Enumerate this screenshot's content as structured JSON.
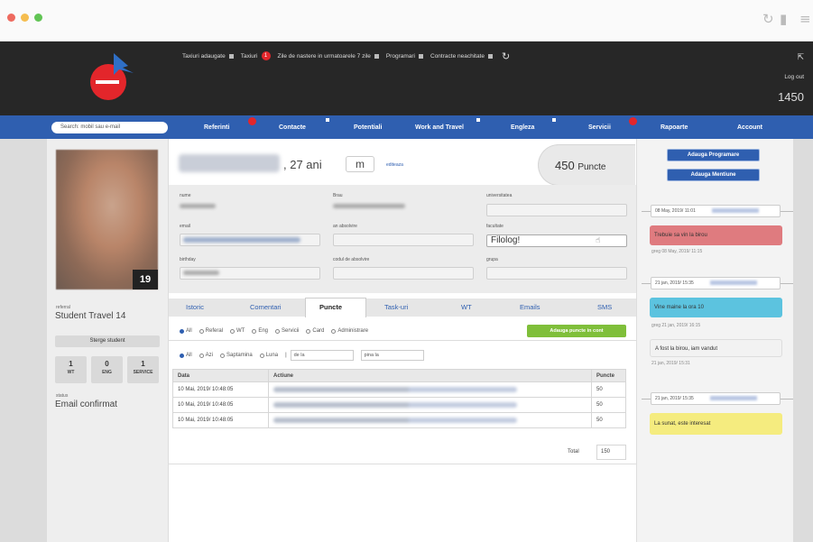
{
  "window": {
    "dots": [
      "#ee6a5f",
      "#f5bd4f",
      "#61c454"
    ],
    "icons": [
      "refresh-icon",
      "trash-icon",
      "menu-icon"
    ]
  },
  "header": {
    "topnav": [
      {
        "label": "Taxiuri adaugate",
        "badge": ""
      },
      {
        "label": "Taxiuri",
        "badge": "1"
      },
      {
        "label": "Zile de nastere in urmatoarele 7 zile",
        "badge": ""
      },
      {
        "label": "Programari",
        "badge": ""
      },
      {
        "label": "Contracte neachitate",
        "badge": ""
      }
    ],
    "logout": "Log out",
    "points": "1450"
  },
  "nav": {
    "search_placeholder": "Search: mobil sau e-mail",
    "items": [
      "Referinti",
      "Contacte",
      "Potentiali",
      "Work and Travel",
      "Engleza",
      "Servicii",
      "Rapoarte",
      "Account"
    ]
  },
  "profile": {
    "age": ", 27 ani",
    "gender": "m",
    "edit_link": "editeaza",
    "age_badge": "19",
    "points": "450",
    "points_unit": "Puncte",
    "fields": {
      "nume": "nume",
      "brau": "Brau",
      "universitate": "universitatea",
      "email": "email",
      "an_absolvire": "an absolvire",
      "facultate": "facultate",
      "facultate_value": "Filolog!",
      "birthday": "birthday",
      "cod_absolvire": "codul de absolvire",
      "grupa": "grupa"
    }
  },
  "left": {
    "referral_label": "referral",
    "referral_value": "Student Travel 14",
    "button": "Sterge student",
    "stats": [
      {
        "n": "1",
        "l": "WT"
      },
      {
        "n": "0",
        "l": "ENG"
      },
      {
        "n": "1",
        "l": "SERVICE"
      }
    ],
    "status_label": "status",
    "status_value": "Email confirmat"
  },
  "tabs": [
    "Istoric",
    "Comentari",
    "Puncte",
    "Task-uri",
    "WT",
    "Emails",
    "SMS"
  ],
  "filters": {
    "type": [
      "All",
      "Referal",
      "WT",
      "Eng",
      "Servicii",
      "Card",
      "Administrare"
    ],
    "add_button": "Adauga puncte in cont",
    "period": [
      "All",
      "Azi",
      "Saptamina",
      "Luna"
    ],
    "from": "de la",
    "to": "pina la"
  },
  "table": {
    "headers": [
      "Data",
      "Actiune",
      "Puncte"
    ],
    "rows": [
      {
        "date": "10 Mai, 2019/ 10:48:05",
        "points": "50"
      },
      {
        "date": "10 Mai, 2019/ 10:48:05",
        "points": "50"
      },
      {
        "date": "10 Mai, 2019/ 10:48:05",
        "points": "50"
      }
    ],
    "total_label": "Total",
    "total_value": "150"
  },
  "right": {
    "btn_programare": "Adauga Programare",
    "btn_mentiune": "Adauga Mentiune",
    "entries": [
      {
        "date": "08 May, 2019/ 11:01",
        "note": "Trebuie sa vin la birou",
        "meta": "greg 08 May, 2019/ 11:15",
        "color": "#df7b7f"
      },
      {
        "date": "21 jan, 2019/ 15:35",
        "note": "Vine maine la ora 10",
        "meta": "greg 21 jan, 2019/ 16:15",
        "color": "#5cc3df"
      },
      {
        "date": "",
        "note": "A fost la birou, iam vandut",
        "meta": "21 jan, 2019/ 15:31",
        "color": "#f2f2f2"
      },
      {
        "date": "21 jan, 2019/ 15:35",
        "note": "La sunat, este interesat",
        "meta": "",
        "color": "#f5ec7f"
      }
    ]
  }
}
